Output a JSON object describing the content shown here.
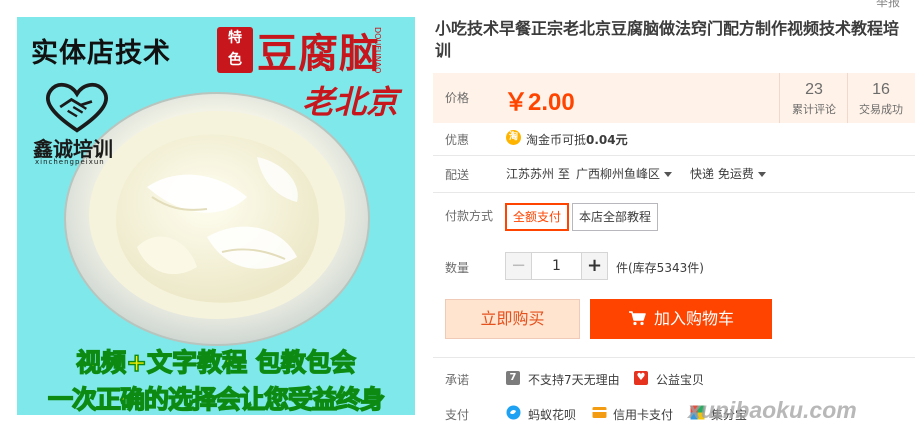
{
  "image": {
    "slogan_top": "实体店技术",
    "badge_top": "特",
    "badge_bottom": "色",
    "brand": "豆腐脑",
    "brand_pinyin": "DOUFUNAO",
    "city": "老北京",
    "logo_name": "鑫诚培训",
    "logo_pinyin": "xinchengpeixun",
    "slogan_mid": "视频+文字教程 包教包会",
    "slogan_bottom": "一次正确的选择会让您受益终身",
    "bg_color": "#7fe8ea"
  },
  "report_link": "举报",
  "title": "小吃技术早餐正宗老北京豆腐脑做法窍门配方制作视频技术教程培训",
  "price": {
    "label": "价格",
    "value": "￥2.00",
    "reviews_count": "23",
    "reviews_label": "累计评论",
    "sales_count": "16",
    "sales_label": "交易成功",
    "accent": "#ff4400"
  },
  "discount": {
    "label": "优惠",
    "icon": "coin-icon",
    "text_prefix": "淘金币可抵",
    "amount": "0.04元"
  },
  "delivery": {
    "label": "配送",
    "from": "江苏苏州 至",
    "to": "广西柳州鱼峰区",
    "method": "快递 免运费"
  },
  "payment_mode": {
    "label": "付款方式",
    "options": [
      "全额支付",
      "本店全部教程"
    ],
    "selected": "全额支付"
  },
  "quantity": {
    "label": "数量",
    "minus": "−",
    "value": "1",
    "plus": "+",
    "stock": "件(库存5343件)"
  },
  "actions": {
    "buy_now": "立即购买",
    "add_cart": "加入购物车"
  },
  "promise": {
    "label": "承诺",
    "items": [
      {
        "icon": "no-return-icon",
        "text": "不支持7天无理由"
      },
      {
        "icon": "charity-icon",
        "text": "公益宝贝"
      }
    ]
  },
  "pay": {
    "label": "支付",
    "items": [
      {
        "icon": "huabei-icon",
        "text": "蚂蚁花呗"
      },
      {
        "icon": "credit-card-icon",
        "text": "信用卡支付"
      },
      {
        "icon": "alipay-icon",
        "text": "集分宝"
      }
    ]
  },
  "watermark": "xunibaoku.com"
}
